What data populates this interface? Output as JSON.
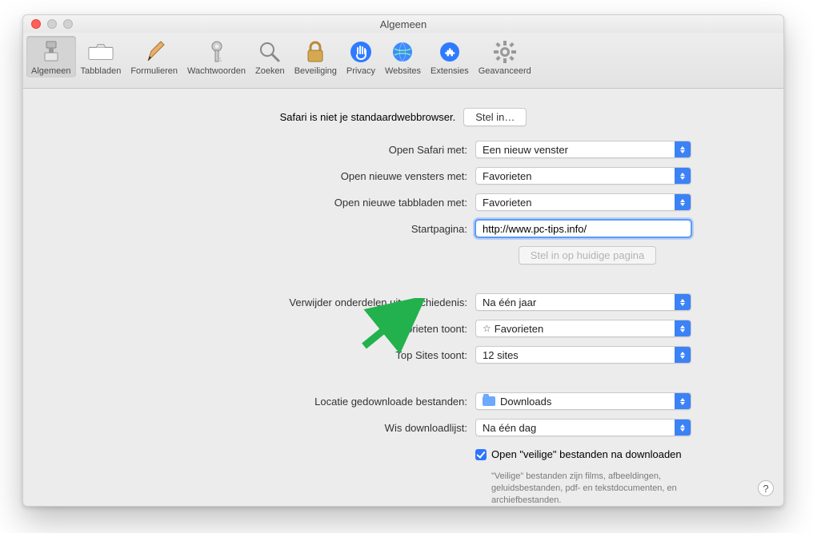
{
  "window": {
    "title": "Algemeen"
  },
  "toolbar": {
    "items": [
      {
        "label": "Algemeen"
      },
      {
        "label": "Tabbladen"
      },
      {
        "label": "Formulieren"
      },
      {
        "label": "Wachtwoorden"
      },
      {
        "label": "Zoeken"
      },
      {
        "label": "Beveiliging"
      },
      {
        "label": "Privacy"
      },
      {
        "label": "Websites"
      },
      {
        "label": "Extensies"
      },
      {
        "label": "Geavanceerd"
      }
    ]
  },
  "default_browser": {
    "message": "Safari is niet je standaardwebbrowser.",
    "button": "Stel in…"
  },
  "form": {
    "open_safari_with": {
      "label": "Open Safari met:",
      "value": "Een nieuw venster"
    },
    "open_new_windows": {
      "label": "Open nieuwe vensters met:",
      "value": "Favorieten"
    },
    "open_new_tabs": {
      "label": "Open nieuwe tabbladen met:",
      "value": "Favorieten"
    },
    "homepage": {
      "label": "Startpagina:",
      "value": "http://www.pc-tips.info/"
    },
    "set_to_current": {
      "button": "Stel in op huidige pagina"
    },
    "remove_history": {
      "label": "Verwijder onderdelen uit geschiedenis:",
      "value": "Na één jaar"
    },
    "favorites_shows": {
      "label": "Favorieten toont:",
      "value": "Favorieten"
    },
    "topsites_shows": {
      "label": "Top Sites toont:",
      "value": "12 sites"
    },
    "download_location": {
      "label": "Locatie gedownloade bestanden:",
      "value": "Downloads"
    },
    "clear_downloads": {
      "label": "Wis downloadlijst:",
      "value": "Na één dag"
    },
    "open_safe": {
      "label": "Open \"veilige\" bestanden na downloaden",
      "desc": "\"Veilige\" bestanden zijn films, afbeeldingen, geluidsbestanden, pdf- en tekstdocumenten, en archiefbestanden."
    }
  },
  "help": "?"
}
